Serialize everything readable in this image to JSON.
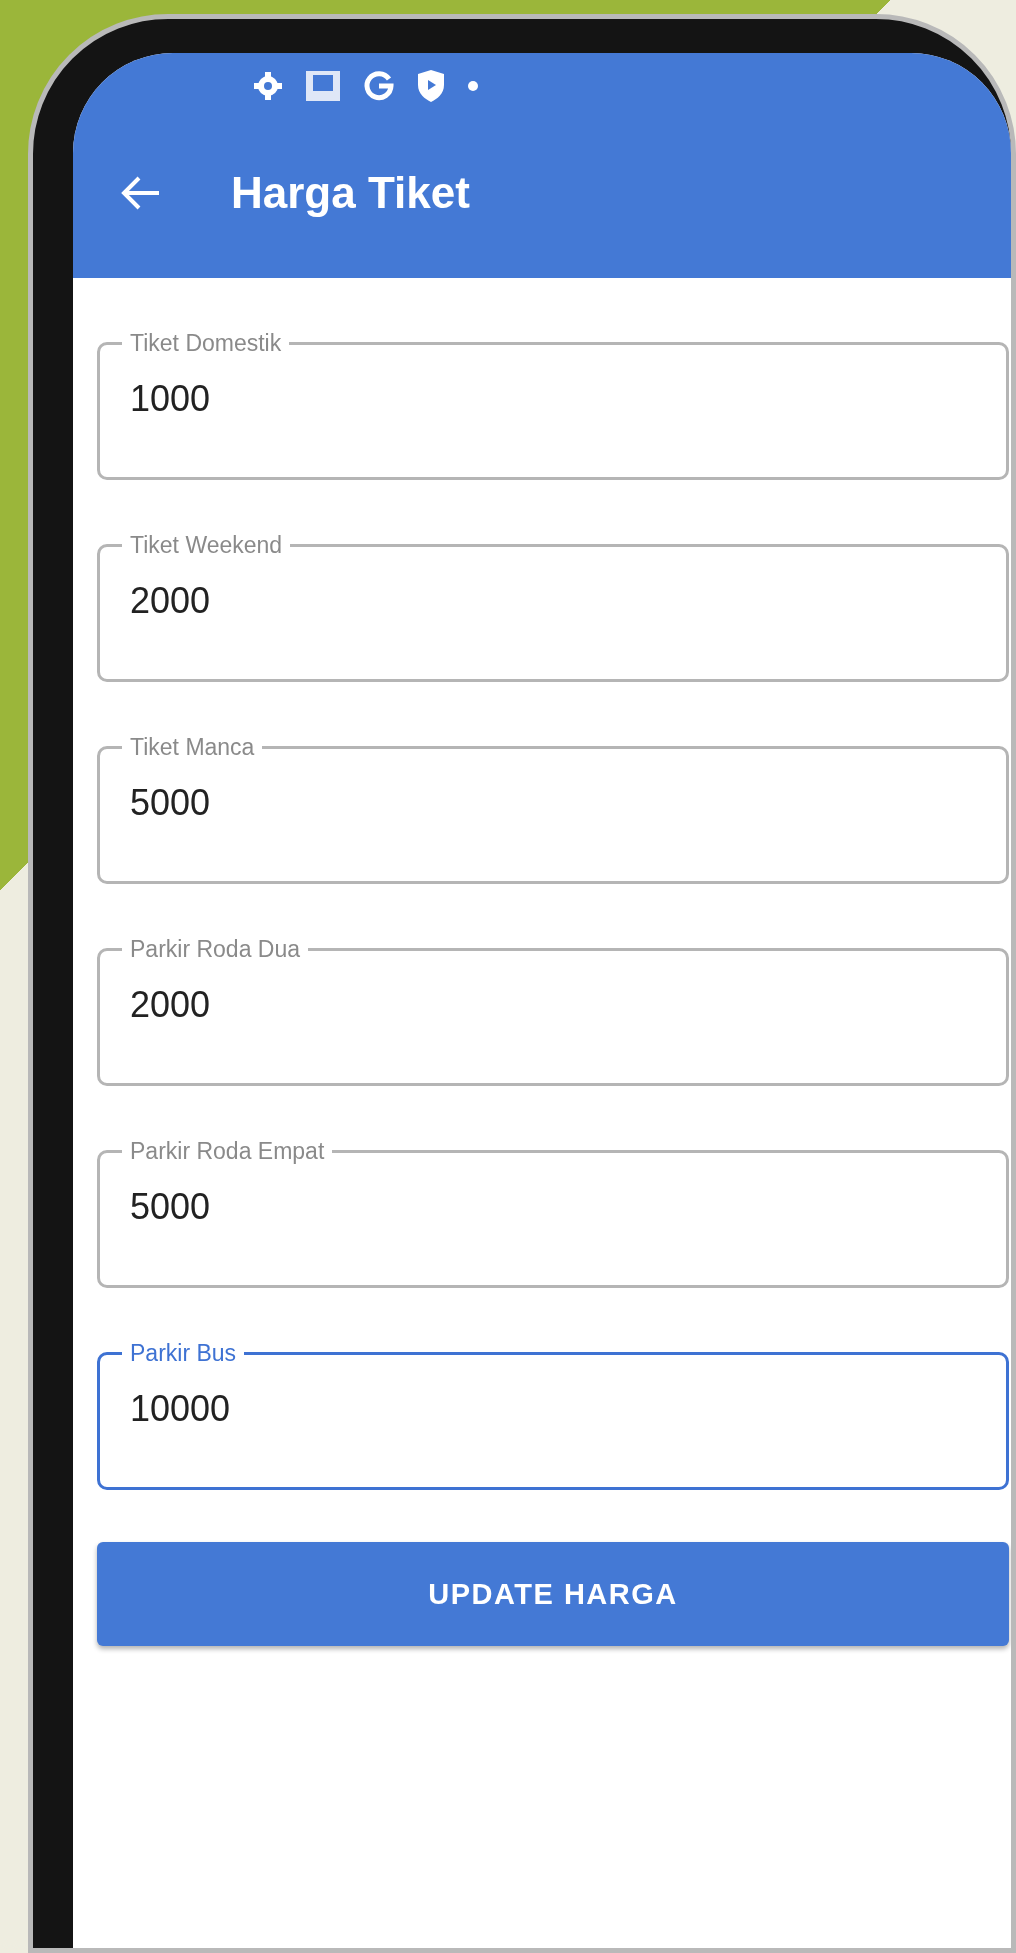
{
  "app_bar": {
    "title": "Harga Tiket"
  },
  "fields": [
    {
      "label": "Tiket Domestik",
      "value": "1000",
      "focused": false
    },
    {
      "label": "Tiket Weekend",
      "value": "2000",
      "focused": false
    },
    {
      "label": "Tiket Manca",
      "value": "5000",
      "focused": false
    },
    {
      "label": "Parkir Roda Dua",
      "value": "2000",
      "focused": false
    },
    {
      "label": "Parkir Roda Empat",
      "value": "5000",
      "focused": false
    },
    {
      "label": "Parkir Bus",
      "value": "10000",
      "focused": true
    }
  ],
  "button": {
    "label": "UPDATE HARGA"
  }
}
